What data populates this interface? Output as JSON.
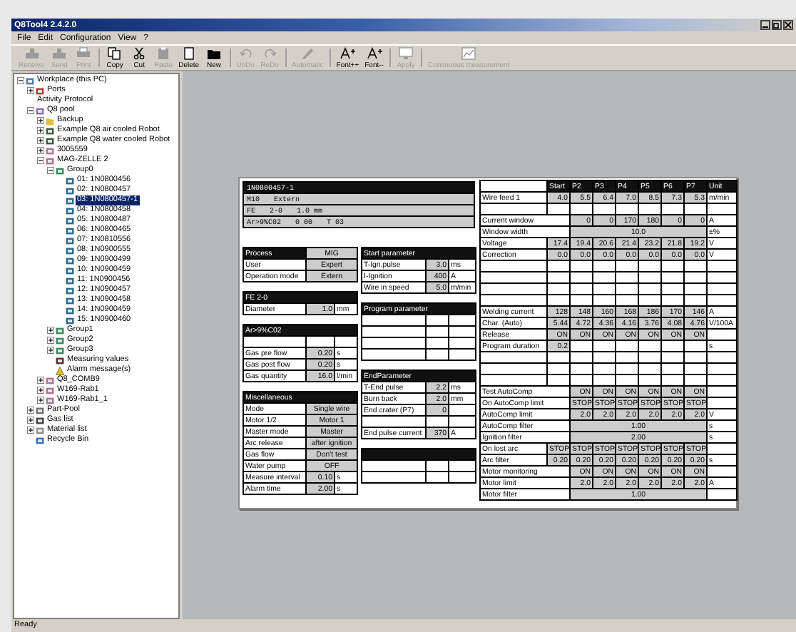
{
  "window": {
    "title": "Q8Tool4 2.4.2.0"
  },
  "menu": [
    "File",
    "Edit",
    "Configuration",
    "View",
    "?"
  ],
  "toolbar": [
    [
      {
        "label": "Receive",
        "kind": "receive",
        "disabled": true
      },
      {
        "label": "Send",
        "kind": "send",
        "disabled": true
      },
      {
        "label": "Print",
        "kind": "print",
        "disabled": true
      }
    ],
    [
      {
        "label": "Copy",
        "kind": "copy",
        "disabled": false
      },
      {
        "label": "Cut",
        "kind": "cut",
        "disabled": false
      },
      {
        "label": "Paste",
        "kind": "paste",
        "disabled": true
      },
      {
        "label": "Delete",
        "kind": "delete",
        "disabled": false
      },
      {
        "label": "New",
        "kind": "new",
        "disabled": false
      }
    ],
    [
      {
        "label": "UnDo",
        "kind": "undo",
        "disabled": true
      },
      {
        "label": "ReDo",
        "kind": "redo",
        "disabled": true
      }
    ],
    [
      {
        "label": "Automatic",
        "kind": "auto",
        "disabled": true
      }
    ],
    [
      {
        "label": "Font++",
        "kind": "font",
        "disabled": false
      },
      {
        "label": "Font--",
        "kind": "font",
        "disabled": false
      }
    ],
    [
      {
        "label": "Apply",
        "kind": "apply",
        "disabled": true
      }
    ],
    [
      {
        "label": "Continuous measurement",
        "kind": "measure",
        "disabled": true
      }
    ]
  ],
  "tree": [
    {
      "label": "Workplace (this PC)",
      "kind": "computer",
      "selected": false,
      "expanded": true,
      "children": [
        {
          "label": "Ports",
          "kind": "ports",
          "selected": false,
          "expanded": false
        },
        {
          "label": "Activity Protocol",
          "kind": "protocol",
          "selected": false
        },
        {
          "label": "Q8 pool",
          "kind": "pool",
          "selected": false,
          "expanded": true,
          "children": [
            {
              "label": "Backup",
              "kind": "folder",
              "selected": false,
              "expanded": false
            },
            {
              "label": "Example Q8 air cooled Robot",
              "kind": "robot",
              "selected": false,
              "expanded": false
            },
            {
              "label": "Example Q8 water cooled Robot",
              "kind": "robot",
              "selected": false,
              "expanded": false
            },
            {
              "label": "3005559",
              "kind": "cell",
              "selected": false,
              "expanded": false
            },
            {
              "label": "MAG-ZELLE 2",
              "kind": "cell",
              "selected": false,
              "expanded": true,
              "children": [
                {
                  "label": "Group0",
                  "kind": "group",
                  "selected": false,
                  "expanded": true,
                  "children": [
                    {
                      "label": "01: 1N0800456",
                      "kind": "job",
                      "selected": false
                    },
                    {
                      "label": "02: 1N0800457",
                      "kind": "job",
                      "selected": false
                    },
                    {
                      "label": "03: 1N0800457-1",
                      "kind": "job",
                      "selected": true
                    },
                    {
                      "label": "04: 1N0800458",
                      "kind": "job",
                      "selected": false
                    },
                    {
                      "label": "05: 1N0800487",
                      "kind": "job",
                      "selected": false
                    },
                    {
                      "label": "06: 1N0800465",
                      "kind": "job",
                      "selected": false
                    },
                    {
                      "label": "07: 1N0810556",
                      "kind": "job",
                      "selected": false
                    },
                    {
                      "label": "08: 1N0900555",
                      "kind": "job",
                      "selected": false
                    },
                    {
                      "label": "09: 1N0900499",
                      "kind": "job",
                      "selected": false
                    },
                    {
                      "label": "10: 1N0900459",
                      "kind": "job",
                      "selected": false
                    },
                    {
                      "label": "11: 1N0900456",
                      "kind": "job",
                      "selected": false
                    },
                    {
                      "label": "12: 1N0900457",
                      "kind": "job",
                      "selected": false
                    },
                    {
                      "label": "13: 1N0900458",
                      "kind": "job",
                      "selected": false
                    },
                    {
                      "label": "14: 1N0900459",
                      "kind": "job",
                      "selected": false
                    },
                    {
                      "label": "15: 1N0900460",
                      "kind": "job",
                      "selected": false
                    }
                  ]
                },
                {
                  "label": "Group1",
                  "kind": "group",
                  "selected": false,
                  "expanded": false
                },
                {
                  "label": "Group2",
                  "kind": "group",
                  "selected": false,
                  "expanded": false
                },
                {
                  "label": "Group3",
                  "kind": "group",
                  "selected": false,
                  "expanded": false
                },
                {
                  "label": "Measuring values",
                  "kind": "measure",
                  "selected": false
                },
                {
                  "label": "Alarm message(s)",
                  "kind": "alarm",
                  "selected": false
                }
              ]
            },
            {
              "label": "Q8_COMB9",
              "kind": "cell",
              "selected": false,
              "expanded": false
            },
            {
              "label": "W169-Rab1",
              "kind": "cell",
              "selected": false,
              "expanded": false
            },
            {
              "label": "W169-Rab1_1",
              "kind": "cell",
              "selected": false,
              "expanded": false
            }
          ]
        },
        {
          "label": "Part-Pool",
          "kind": "partpool",
          "selected": false,
          "expanded": false
        },
        {
          "label": "Gas list",
          "kind": "gas",
          "selected": false,
          "expanded": false
        },
        {
          "label": "Material list",
          "kind": "material",
          "selected": false,
          "expanded": false
        },
        {
          "label": "Recycle Bin",
          "kind": "recycle",
          "selected": false
        }
      ]
    }
  ],
  "document": {
    "header": [
      [
        "1N0800457-1"
      ],
      [
        "M10",
        "Extern"
      ],
      [
        "FE",
        "2-0",
        "1.0 mm"
      ],
      [
        "Ar>9%C02",
        "0 00",
        "T 03"
      ]
    ],
    "left_sections": [
      {
        "title": "Process",
        "title_value": "MIG",
        "rows": [
          {
            "kind": "wide",
            "label": "User",
            "value": "Expert"
          },
          {
            "kind": "wide",
            "label": "Operation mode",
            "value": "Extern"
          }
        ]
      },
      {
        "title": "FE   2-0",
        "rows": [
          {
            "kind": "unit",
            "label": "Diameter",
            "value": "1.0",
            "unit": "mm"
          }
        ]
      },
      {
        "title": "Ar>9%C02",
        "rows": [
          {
            "kind": "blank"
          },
          {
            "kind": "unit",
            "label": "Gas pre flow",
            "value": "0.20",
            "unit": "s"
          },
          {
            "kind": "unit",
            "label": "Gas post flow",
            "value": "0.20",
            "unit": "s"
          },
          {
            "kind": "unit",
            "label": "Gas quantity",
            "value": "16.0",
            "unit": "l/min"
          }
        ]
      },
      {
        "title": "Miscellaneous",
        "rows": [
          {
            "kind": "wide",
            "label": "Mode",
            "value": "Single wire"
          },
          {
            "kind": "wide",
            "label": "Motor 1/2",
            "value": "Motor 1"
          },
          {
            "kind": "wide",
            "label": "Master mode",
            "value": "Master"
          },
          {
            "kind": "wide",
            "label": "Arc release",
            "value": "after ignition"
          },
          {
            "kind": "wide",
            "label": "Gas flow",
            "value": "Don't test"
          },
          {
            "kind": "wide",
            "label": "Water pump",
            "value": "OFF"
          },
          {
            "kind": "unit",
            "label": "Measure interval",
            "value": "0.10",
            "unit": "s"
          },
          {
            "kind": "unit",
            "label": "Alarm time",
            "value": "2.00",
            "unit": "s"
          }
        ]
      }
    ],
    "middle_sections": [
      {
        "title": "Start parameter",
        "rows": [
          {
            "kind": "unit",
            "label": "T-Ign.pulse",
            "value": "3.0",
            "unit": "ms"
          },
          {
            "kind": "unit",
            "label": "I-Ignition",
            "value": "400",
            "unit": "A"
          },
          {
            "kind": "unit",
            "label": "Wire in speed",
            "value": "5.0",
            "unit": "m/min"
          }
        ]
      },
      {
        "title": "Program parameter",
        "rows": [
          {
            "kind": "blank"
          },
          {
            "kind": "blank"
          },
          {
            "kind": "blank"
          },
          {
            "kind": "blank"
          }
        ]
      },
      {
        "title": "EndParameter",
        "rows": [
          {
            "kind": "unit",
            "label": "T-End pulse",
            "value": "2.2",
            "unit": "ms"
          },
          {
            "kind": "unit",
            "label": "Burn back",
            "value": "2.0",
            "unit": "mm"
          },
          {
            "kind": "unit",
            "label": "End crater (P7)",
            "value": "0"
          },
          {
            "kind": "blank"
          },
          {
            "kind": "unit",
            "label": "End pulse current",
            "value": "370",
            "unit": "A"
          }
        ]
      },
      {
        "rows": [
          {
            "kind": "blank"
          },
          {
            "kind": "blank"
          }
        ]
      }
    ],
    "program": {
      "columns": [
        "Start",
        "P2",
        "P3",
        "P4",
        "P5",
        "P6",
        "P7",
        "Unit"
      ],
      "rows": [
        {
          "kind": "full",
          "label": "Wire feed 1",
          "values": [
            "4.0",
            "5.5",
            "6.4",
            "7.0",
            "8.5",
            "7.3",
            "5.3"
          ],
          "unit": "m/min"
        },
        {
          "kind": "blank"
        },
        {
          "kind": "wide",
          "label": "Current window",
          "values": [
            "0",
            "0",
            "170",
            "180",
            "0",
            "0"
          ],
          "unit": "A"
        },
        {
          "kind": "span",
          "label": "Window width",
          "value": "10.0",
          "unit": "±%"
        },
        {
          "kind": "full",
          "label": "Voltage",
          "values": [
            "17.4",
            "19.4",
            "20.6",
            "21.4",
            "23.2",
            "21.8",
            "19.2"
          ],
          "unit": "V"
        },
        {
          "kind": "full",
          "label": "Correction",
          "values": [
            "0.0",
            "0.0",
            "0.0",
            "0.0",
            "0.0",
            "0.0",
            "0.0"
          ],
          "unit": "V"
        },
        {
          "kind": "blank"
        },
        {
          "kind": "blank"
        },
        {
          "kind": "blank"
        },
        {
          "kind": "blank"
        },
        {
          "kind": "full",
          "label": "Welding current",
          "values": [
            "128",
            "148",
            "160",
            "168",
            "186",
            "170",
            "146"
          ],
          "unit": "A"
        },
        {
          "kind": "full",
          "label": "Char. (Auto)",
          "values": [
            "5.44",
            "4.72",
            "4.36",
            "4.16",
            "3.76",
            "4.08",
            "4.76"
          ],
          "unit": "V/100A"
        },
        {
          "kind": "full",
          "label": "Release",
          "values": [
            "ON",
            "ON",
            "ON",
            "ON",
            "ON",
            "ON",
            "ON"
          ]
        },
        {
          "kind": "full",
          "label": "Program duration",
          "values": [
            "0.2"
          ],
          "unit": "s"
        },
        {
          "kind": "blank"
        },
        {
          "kind": "blank"
        },
        {
          "kind": "blank"
        },
        {
          "kind": "wide",
          "label": "Test AutoComp",
          "values": [
            "ON",
            "ON",
            "ON",
            "ON",
            "ON",
            "ON"
          ]
        },
        {
          "kind": "wide",
          "label": "On AutoComp limit",
          "values": [
            "STOP",
            "STOP",
            "STOP",
            "STOP",
            "STOP",
            "STOP"
          ]
        },
        {
          "kind": "wide",
          "label": "AutoComp limit",
          "values": [
            "2.0",
            "2.0",
            "2.0",
            "2.0",
            "2.0",
            "2.0"
          ],
          "unit": "V"
        },
        {
          "kind": "span",
          "label": "AutoComp filter",
          "value": "1.00",
          "unit": "s"
        },
        {
          "kind": "span",
          "label": "Ignition filter",
          "value": "2.00",
          "unit": "s"
        },
        {
          "kind": "full",
          "label": "On lost arc",
          "values": [
            "STOP",
            "STOP",
            "STOP",
            "STOP",
            "STOP",
            "STOP",
            "STOP"
          ]
        },
        {
          "kind": "full",
          "label": "Arc filter",
          "values": [
            "0.20",
            "0.20",
            "0.20",
            "0.20",
            "0.20",
            "0.20",
            "0.20"
          ],
          "unit": "s"
        },
        {
          "kind": "wide",
          "label": "Motor monitoring",
          "values": [
            "ON",
            "ON",
            "ON",
            "ON",
            "ON",
            "ON"
          ]
        },
        {
          "kind": "wide",
          "label": "Motor limit",
          "values": [
            "2.0",
            "2.0",
            "2.0",
            "2.0",
            "2.0",
            "2.0"
          ],
          "unit": "A"
        },
        {
          "kind": "span",
          "label": "Motor filter",
          "value": "1.00"
        }
      ]
    }
  },
  "status_bar": "Ready"
}
